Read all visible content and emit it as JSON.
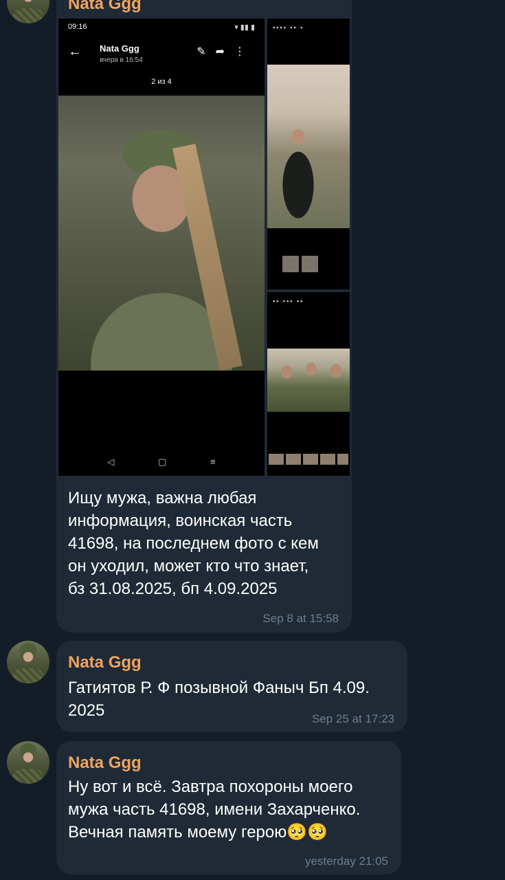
{
  "messages": [
    {
      "sender": "Nata Ggg",
      "text": "Ищу мужа, важна любая\nинформация, воинская часть\n41698, на последнем фото с кем\nон уходил, может кто что знает,\nбз 31.08.2025, бп 4.09.2025",
      "time": "Sep 8 at 15:58",
      "photo": {
        "status_time": "09:16",
        "contact_name": "Nata Ggg",
        "contact_subtitle": "вчера в 16:54",
        "counter": "2 из 4"
      }
    },
    {
      "sender": "Nata Ggg",
      "text": "Гатиятов Р. Ф позывной Фаныч Бп 4.09.\n2025",
      "time": "Sep 25 at 17:23"
    },
    {
      "sender": "Nata Ggg",
      "text": "Ну вот и всё. Завтра похороны моего\nмужа часть 41698, имени Захарченко.\nВечная память моему герою🥺🥺",
      "time": "yesterday 21:05"
    }
  ],
  "colors": {
    "background": "#141d27",
    "bubble": "#1f2a36",
    "sender_name": "#f2a35d",
    "timestamp": "#6d7d8e"
  },
  "icons": [
    "back-arrow-icon",
    "edit-icon",
    "share-icon",
    "more-icon",
    "nav-back-icon",
    "nav-home-icon",
    "nav-recents-icon"
  ]
}
